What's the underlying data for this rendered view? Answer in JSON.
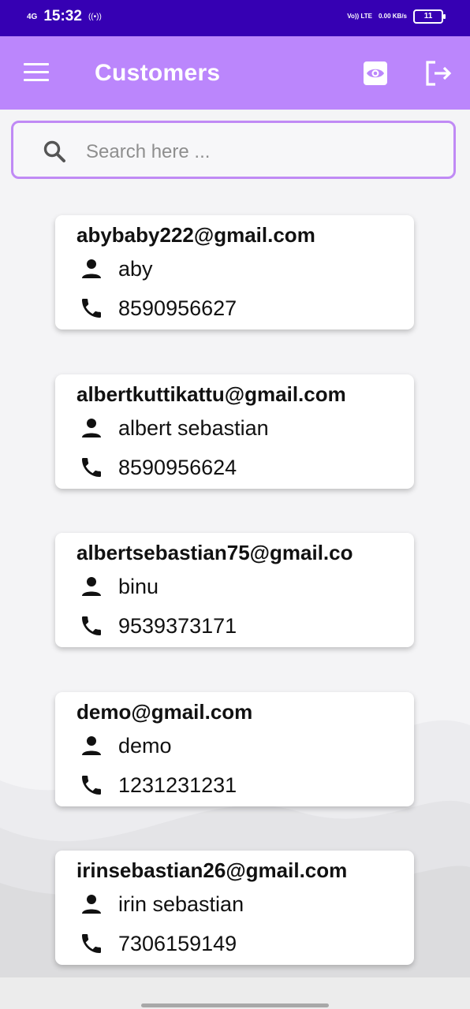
{
  "status_bar": {
    "network": "4G",
    "time": "15:32",
    "hotspot": "((•))",
    "volte_top": "Vo)) LTE",
    "speed": "0.00 KB/s",
    "battery": "11"
  },
  "app_bar": {
    "title": "Customers",
    "menu_icon": "menu-icon",
    "view_icon": "eye-icon",
    "logout_icon": "logout-icon",
    "color": "#bb86fc"
  },
  "search": {
    "placeholder": "Search here ...",
    "value": ""
  },
  "customers": [
    {
      "email": "abybaby222@gmail.com",
      "name": "aby",
      "phone": "8590956627"
    },
    {
      "email": "albertkuttikattu@gmail.com",
      "name": "albert sebastian",
      "phone": "8590956624"
    },
    {
      "email": "albertsebastian75@gmail.co",
      "name": "binu",
      "phone": "9539373171"
    },
    {
      "email": "demo@gmail.com",
      "name": "demo",
      "phone": "1231231231"
    },
    {
      "email": "irinsebastian26@gmail.com",
      "name": "irin sebastian",
      "phone": "7306159149"
    }
  ],
  "colors": {
    "status_bar": "#3600b3",
    "accent": "#bb86fc",
    "search_border": "#c08af5"
  }
}
